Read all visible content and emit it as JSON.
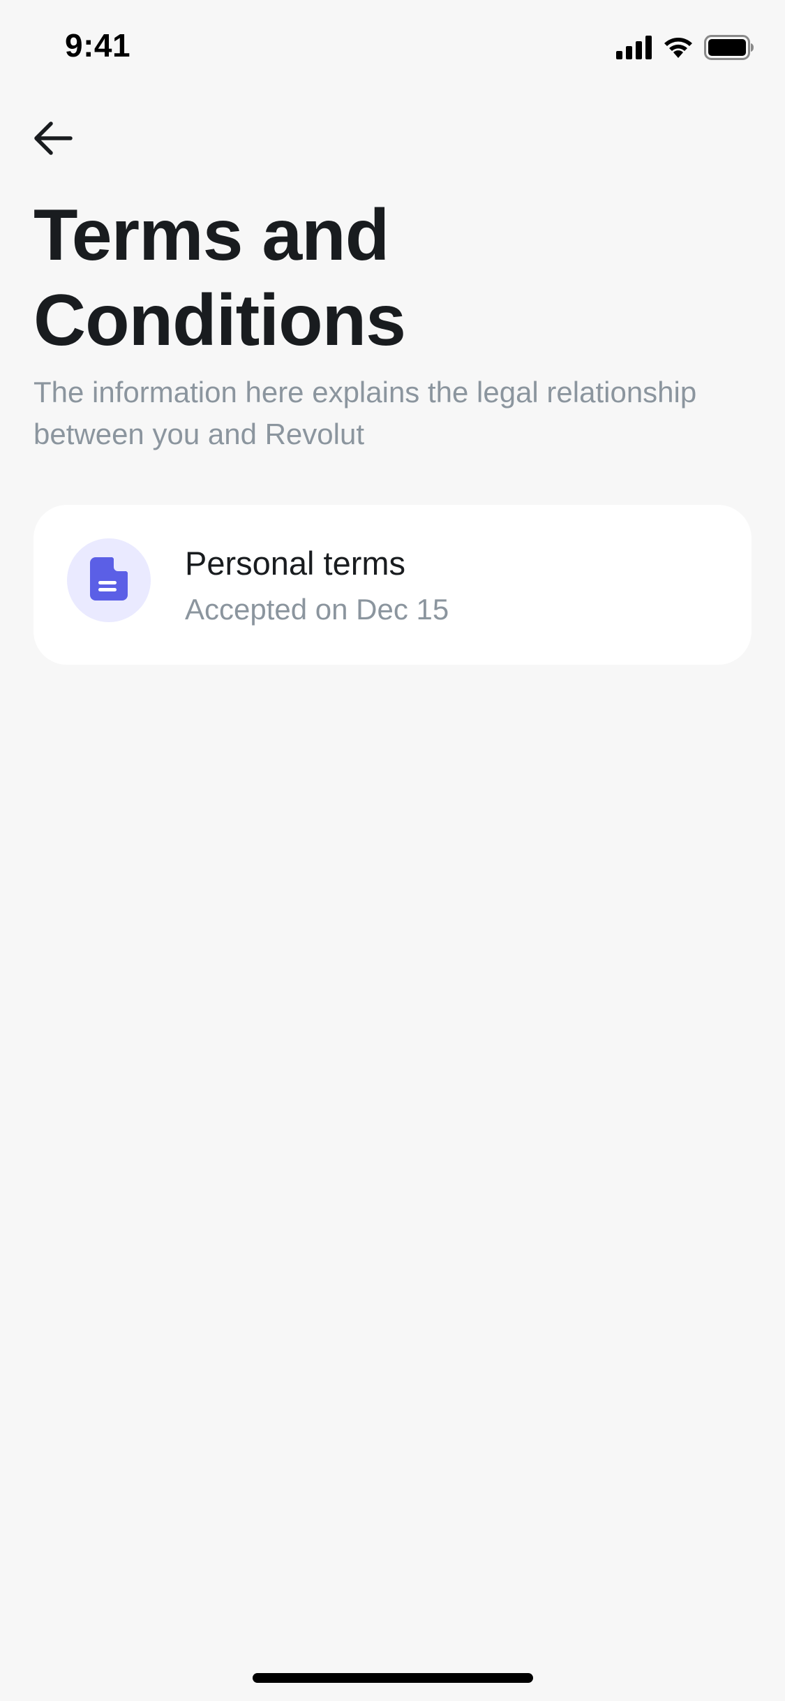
{
  "status_bar": {
    "time": "9:41",
    "signal_icon": "cellular-signal-icon",
    "wifi_icon": "wifi-icon",
    "battery_icon": "battery-icon"
  },
  "header": {
    "back_icon": "arrow-left-icon",
    "title": "Terms and Conditions",
    "subtitle": "The information here explains the legal relationship between you and Revolut"
  },
  "terms_list": [
    {
      "icon": "document-icon",
      "title": "Personal terms",
      "subtitle": "Accepted on Dec 15"
    }
  ],
  "colors": {
    "background": "#f7f7f7",
    "card": "#ffffff",
    "accent": "#5b5fe6",
    "icon_bg": "#eaeaff",
    "text_primary": "#191c1f",
    "text_secondary": "#8b959e"
  }
}
